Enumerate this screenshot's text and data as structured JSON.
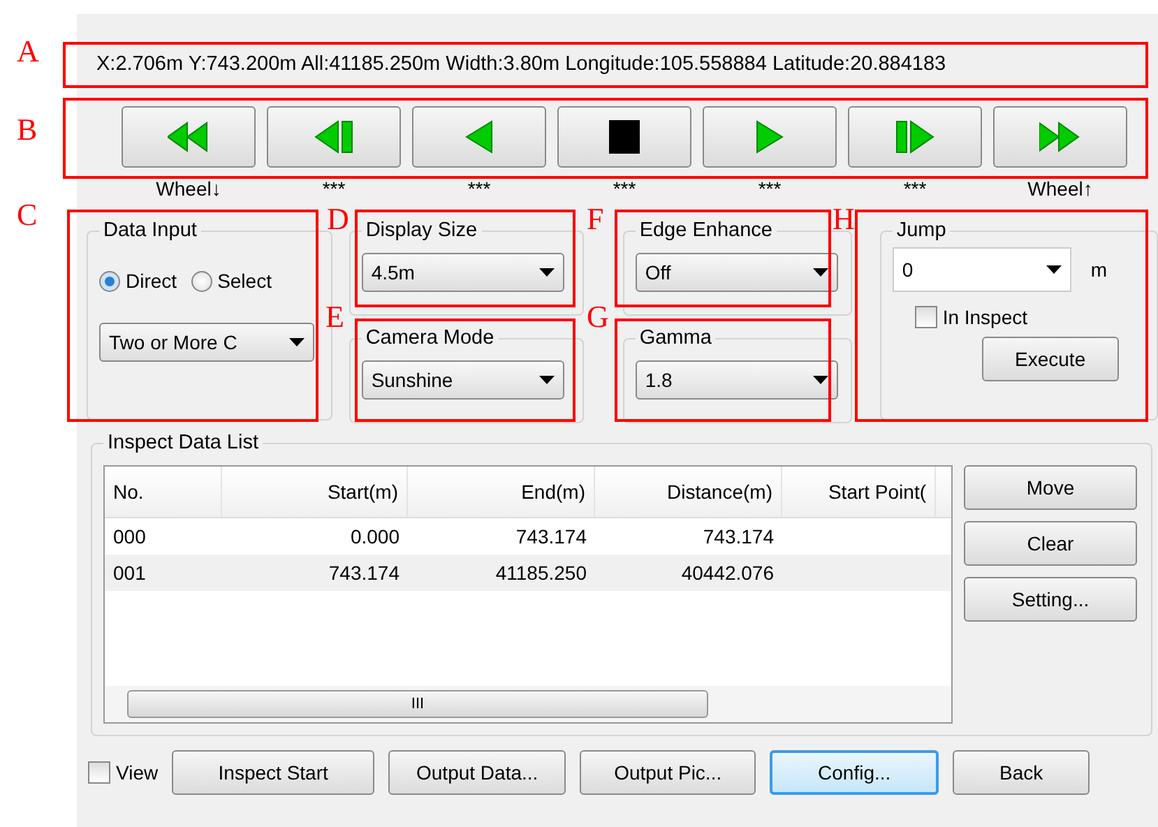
{
  "status_text": "X:2.706m Y:743.200m All:41185.250m Width:3.80m Longitude:105.558884 Latitude:20.884183",
  "transport": {
    "labels": [
      "Wheel↓",
      "***",
      "***",
      "***",
      "***",
      "***",
      "Wheel↑"
    ]
  },
  "data_input": {
    "title": "Data Input",
    "options": [
      {
        "label": "Direct",
        "selected": true
      },
      {
        "label": "Select",
        "selected": false
      }
    ],
    "combo": "Two or More C"
  },
  "display_size": {
    "title": "Display Size",
    "value": "4.5m"
  },
  "camera_mode": {
    "title": "Camera Mode",
    "value": "Sunshine"
  },
  "edge_enhance": {
    "title": "Edge Enhance",
    "value": "Off"
  },
  "gamma": {
    "title": "Gamma",
    "value": "1.8"
  },
  "jump": {
    "title": "Jump",
    "value": "0",
    "unit": "m",
    "in_inspect": {
      "label": "In Inspect",
      "checked": false
    },
    "button": "Execute"
  },
  "inspect_list": {
    "title": "Inspect Data List",
    "columns": [
      "No.",
      "Start(m)",
      "End(m)",
      "Distance(m)",
      "Start Point("
    ],
    "rows": [
      [
        "000",
        "0.000",
        "743.174",
        "743.174"
      ],
      [
        "001",
        "743.174",
        "41185.250",
        "40442.076"
      ]
    ],
    "scroll_grip": "III",
    "buttons": [
      "Move",
      "Clear",
      "Setting..."
    ]
  },
  "bottom": {
    "view": {
      "label": "View",
      "checked": false
    },
    "buttons": [
      {
        "label": "Inspect Start",
        "focused": false
      },
      {
        "label": "Output Data...",
        "focused": false
      },
      {
        "label": "Output Pic...",
        "focused": false
      },
      {
        "label": "Config...",
        "focused": true
      },
      {
        "label": "Back",
        "focused": false
      }
    ]
  },
  "annotations": [
    "A",
    "B",
    "C",
    "D",
    "E",
    "F",
    "G",
    "H"
  ]
}
